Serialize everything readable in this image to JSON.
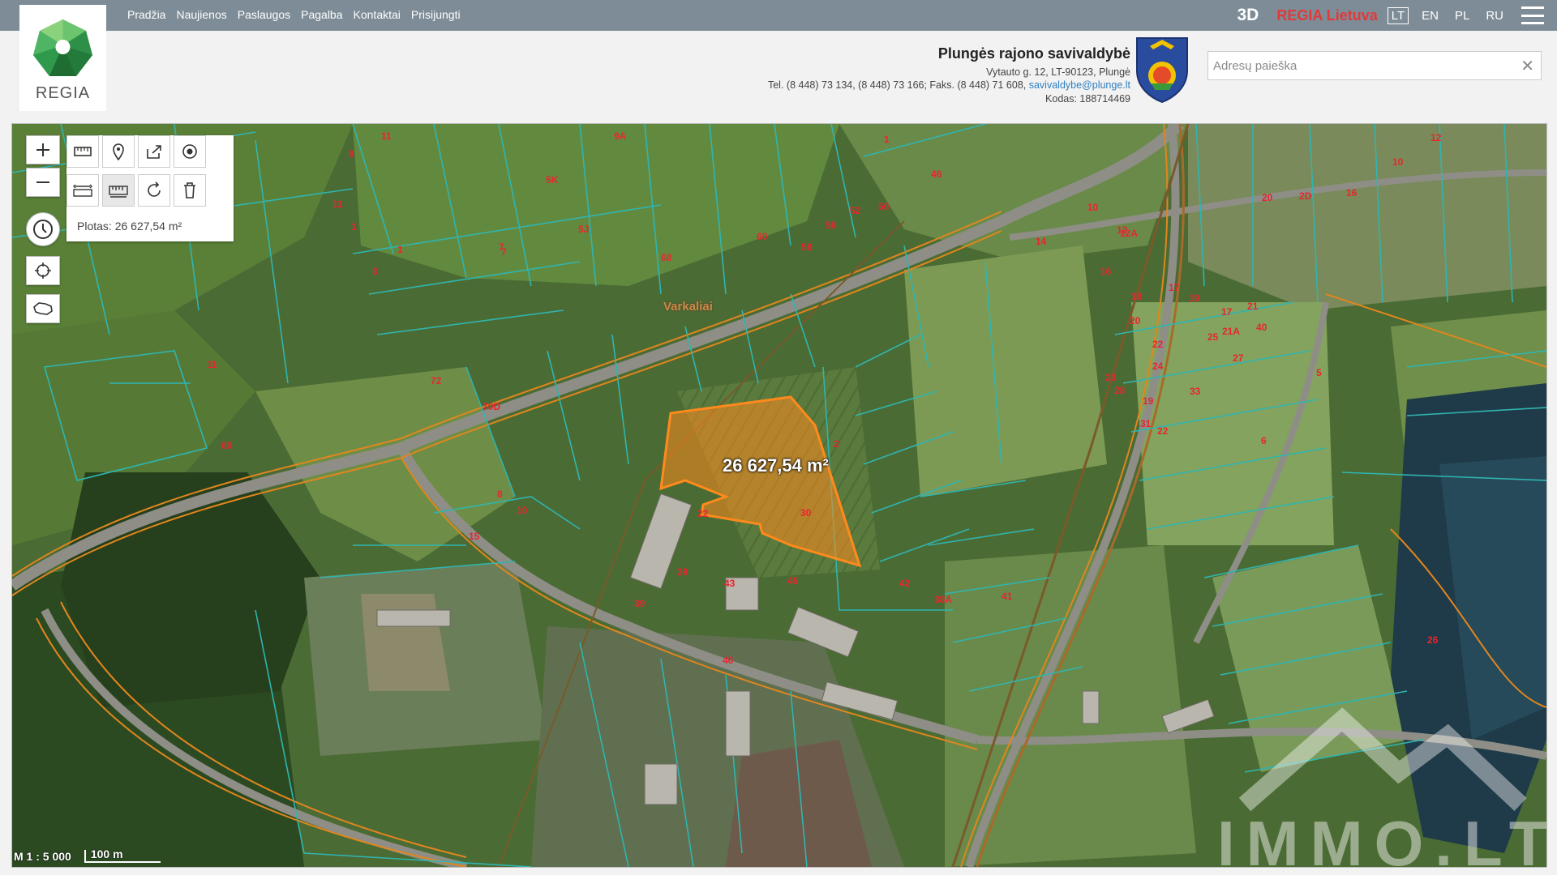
{
  "nav": {
    "links": [
      "Pradžia",
      "Naujienos",
      "Paslaugos",
      "Pagalba",
      "Kontaktai",
      "Prisijungti"
    ]
  },
  "topright": {
    "btn3d": "3D",
    "regia_lietuva": "REGIA Lietuva",
    "languages": [
      "LT",
      "EN",
      "PL",
      "RU"
    ],
    "active_language": "LT"
  },
  "logo": {
    "text": "REGIA"
  },
  "municipality": {
    "name": "Plungės rajono savivaldybė",
    "address": "Vytauto g. 12, LT-90123, Plungė",
    "phones": "Tel. (8 448) 73 134, (8 448) 73 166; Faks. (8 448) 71 608,",
    "email": "savivaldybe@plunge.lt",
    "code": "Kodas: 188714469"
  },
  "search": {
    "placeholder": "Adresų paieška",
    "value": ""
  },
  "map": {
    "measure_result": "Plotas: 26 627,54 m²",
    "area_label": "26 627,54 m²",
    "village_label": "Varkaliai",
    "scale_ratio": "M 1 : 5 000",
    "scale_bar": "100 m",
    "watermark": "IMMO.LT",
    "parcel_numbers": [
      "11",
      "9",
      "11",
      "1",
      "3",
      "1",
      "7",
      "9A",
      "11",
      "72",
      "70D",
      "8",
      "10",
      "80",
      "5K",
      "5J",
      "60",
      "56",
      "58",
      "52",
      "50",
      "46",
      "1",
      "7",
      "68",
      "2",
      "22",
      "30",
      "15",
      "29",
      "43",
      "45",
      "42",
      "38A",
      "41",
      "39",
      "46",
      "10",
      "12",
      "12A",
      "14",
      "16",
      "18",
      "20",
      "22",
      "24",
      "28",
      "19",
      "17",
      "19",
      "17",
      "21",
      "21A",
      "25",
      "27",
      "23",
      "31",
      "33",
      "22",
      "6",
      "5",
      "40",
      "26",
      "20",
      "2D",
      "16",
      "10",
      "12"
    ],
    "colors": {
      "parcel_outline": "#2fb5b0",
      "road_outline": "#e0861e",
      "selection": "#ff8a1c",
      "label": "#e8262f"
    }
  },
  "icons": {
    "zoom_in": "plus-icon",
    "zoom_out": "minus-icon",
    "history": "clock-icon",
    "locate": "crosshair-icon",
    "lithuania": "lithuania-map-icon",
    "measure_area": "ruler-area-icon",
    "marker": "map-marker-icon",
    "share": "share-icon",
    "target": "target-icon",
    "measure_distance": "ruler-distance-icon",
    "measure_polygon": "ruler-polygon-icon",
    "reset": "reset-icon",
    "delete": "trash-icon",
    "menu": "hamburger-icon"
  }
}
